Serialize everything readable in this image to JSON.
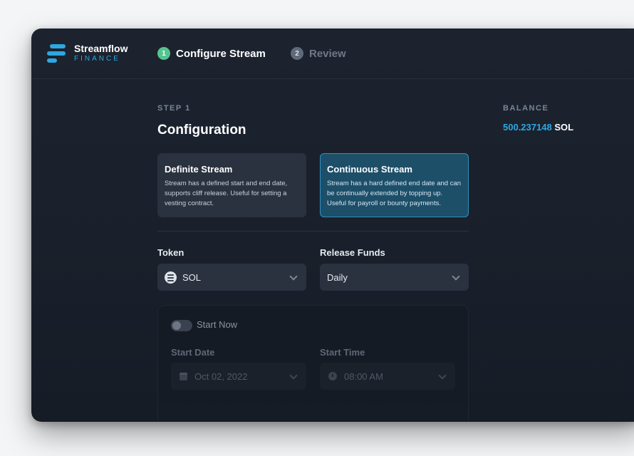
{
  "brand": {
    "name": "Streamflow",
    "subtitle": "FINANCE",
    "accent_color": "#2ba8e3"
  },
  "steps": [
    {
      "number": "1",
      "label": "Configure Stream",
      "active": true
    },
    {
      "number": "2",
      "label": "Review",
      "active": false
    }
  ],
  "main": {
    "step_label": "STEP 1",
    "title": "Configuration"
  },
  "balance": {
    "label": "BALANCE",
    "amount": "500.237148",
    "unit": "SOL"
  },
  "stream_types": [
    {
      "title": "Definite Stream",
      "description": "Stream has a defined start and end date, supports cliff release. Useful for setting a vesting contract.",
      "selected": false
    },
    {
      "title": "Continuous Stream",
      "description": "Stream has a hard defined end date and can be continually extended by topping up. Useful for payroll or bounty payments.",
      "selected": true
    }
  ],
  "form": {
    "token_label": "Token",
    "token_value": "SOL",
    "token_icon": "solana-icon",
    "release_label": "Release Funds",
    "release_value": "Daily",
    "start_now_label": "Start Now",
    "start_now_enabled": false,
    "start_date_label": "Start Date",
    "start_date_value": "Oct 02, 2022",
    "start_time_label": "Start Time",
    "start_time_value": "08:00 AM"
  }
}
